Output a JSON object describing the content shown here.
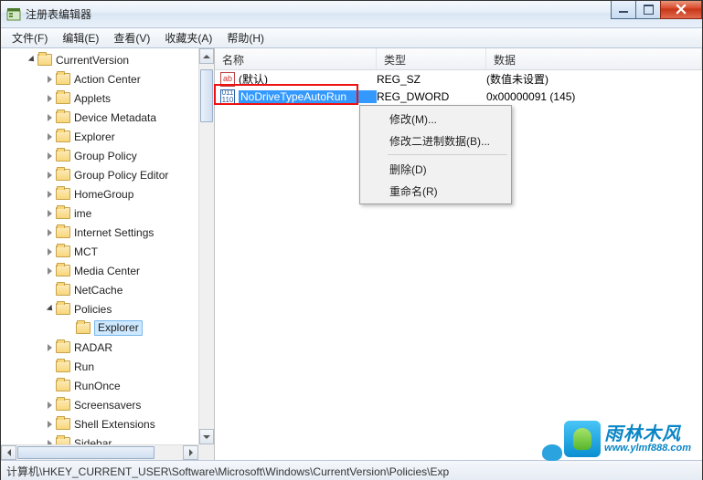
{
  "window": {
    "title": "注册表编辑器"
  },
  "menubar": {
    "file": "文件(F)",
    "edit": "编辑(E)",
    "view": "查看(V)",
    "favorites": "收藏夹(A)",
    "help": "帮助(H)"
  },
  "tree": {
    "root": "CurrentVersion",
    "items": [
      "Action Center",
      "Applets",
      "Device Metadata",
      "Explorer",
      "Group Policy",
      "Group Policy Editor",
      "HomeGroup",
      "ime",
      "Internet Settings",
      "MCT",
      "Media Center",
      "NetCache"
    ],
    "policies": "Policies",
    "policies_child": "Explorer",
    "items2": [
      "RADAR",
      "Run",
      "RunOnce",
      "Screensavers",
      "Shell Extensions",
      "Sidebar"
    ]
  },
  "list": {
    "headers": {
      "name": "名称",
      "type": "类型",
      "data": "数据"
    },
    "rows": [
      {
        "name": "(默认)",
        "type": "REG_SZ",
        "data": "(数值未设置)",
        "kind": "str"
      },
      {
        "name": "NoDriveTypeAutoRun",
        "type": "REG_DWORD",
        "data": "0x00000091 (145)",
        "kind": "bin"
      }
    ]
  },
  "context_menu": {
    "modify": "修改(M)...",
    "modify_binary": "修改二进制数据(B)...",
    "delete": "删除(D)",
    "rename": "重命名(R)"
  },
  "statusbar": {
    "path": "计算机\\HKEY_CURRENT_USER\\Software\\Microsoft\\Windows\\CurrentVersion\\Policies\\Exp"
  },
  "logo": {
    "cn": "雨林木风",
    "url": "www.ylmf888.com"
  }
}
